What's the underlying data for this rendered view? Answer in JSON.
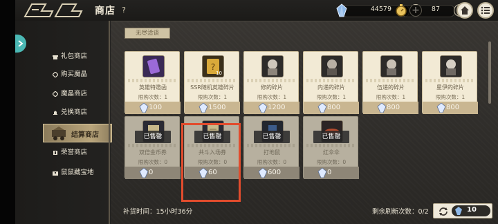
{
  "header": {
    "title": "商店",
    "help_icon": "question-icon",
    "gems": "44579",
    "coins": "87"
  },
  "sidebar": {
    "items": [
      {
        "label": "礼包商店",
        "icon": "gift-icon"
      },
      {
        "label": "购买魔晶",
        "icon": "gem-icon"
      },
      {
        "label": "魔晶商店",
        "icon": "gem-shop-icon"
      },
      {
        "label": "兑换商店",
        "icon": "bell-icon"
      },
      {
        "label": "结算商店",
        "icon": "wagon-icon"
      },
      {
        "label": "荣誉商店",
        "icon": "honor-icon"
      },
      {
        "label": "鼠鼠藏宝地",
        "icon": "treasure-icon"
      }
    ],
    "active_index": 4
  },
  "main": {
    "section_tag": "无尽洽谈",
    "cards": [
      {
        "name": "英雄特邀函",
        "limit": "限购次数：1",
        "price": "100",
        "sold": false,
        "count": ""
      },
      {
        "name": "SSR随机英雄碎片",
        "limit": "限购次数：1",
        "price": "1500",
        "sold": false,
        "count": "10"
      },
      {
        "name": "修的碎片",
        "limit": "限购次数：1",
        "price": "1200",
        "sold": false,
        "count": ""
      },
      {
        "name": "内递的碎片",
        "limit": "限购次数：1",
        "price": "800",
        "sold": false,
        "count": ""
      },
      {
        "name": "伍递的碎片",
        "limit": "限购次数：1",
        "price": "800",
        "sold": false,
        "count": ""
      },
      {
        "name": "星伊的碎片",
        "limit": "限购次数：1",
        "price": "800",
        "sold": false,
        "count": ""
      },
      {
        "name": "双倍金币券",
        "limit": "限购次数：0",
        "price": "0",
        "sold": true,
        "count": ""
      },
      {
        "name": "共斗入场券",
        "limit": "限购次数：0",
        "price": "60",
        "sold": true,
        "count": ""
      },
      {
        "name": "打地鼠",
        "limit": "限购次数：0",
        "price": "600",
        "sold": true,
        "count": ""
      },
      {
        "name": "红伞伞",
        "limit": "限购次数：0",
        "price": "0",
        "sold": true,
        "count": ""
      }
    ],
    "sold_label": "已售罄"
  },
  "footer": {
    "restock_label": "补货时间：",
    "restock_time": "15小时36分",
    "refresh_label": "剩余刷新次数：",
    "refresh_count": "0/2",
    "refresh_cost": "10"
  },
  "colors": {
    "accent_teal": "#4bb8b4",
    "highlight_red": "#e24c2d",
    "card_bg": "#f2ead5",
    "price_bar": "#c9b691"
  }
}
